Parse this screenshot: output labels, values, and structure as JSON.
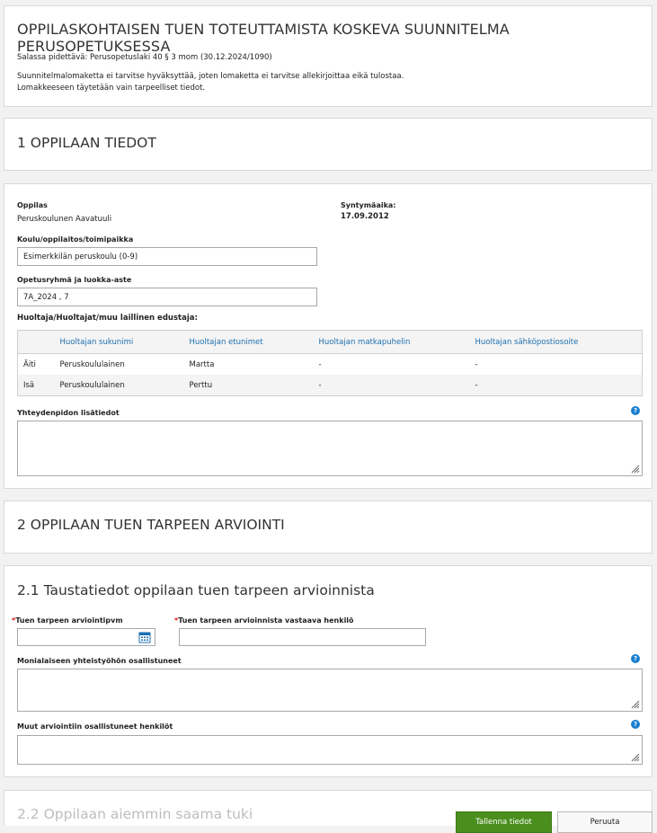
{
  "header": {
    "title": "OPPILASKOHTAISEN TUEN TOTEUTTAMISTA KOSKEVA SUUNNITELMA PERUSOPETUKSESSA",
    "confidential": "Salassa pidettävä: Perusopetuslaki 40 § 3 mom (30.12.2024/1090)",
    "note_line1": "Suunnitelmalomaketta ei tarvitse hyväksyttää, joten lomaketta ei tarvitse allekirjoittaa eikä tulostaa.",
    "note_line2": "Lomakkeeseen täytetään vain tarpeelliset tiedot."
  },
  "section1": {
    "title": "1 OPPILAAN TIEDOT"
  },
  "student": {
    "student_label": "Oppilas",
    "student_name": "Peruskoulunen Aavatuuli",
    "birth_label": "Syntymäaika:",
    "birth_date": "17.09.2012",
    "school_label": "Koulu/oppilaitos/toimipaikka",
    "school_value": "Esimerkkilän peruskoulu (0-9)",
    "group_label": "Opetusryhmä ja luokka-aste",
    "group_value": "7A_2024 , 7",
    "guardians_label": "Huoltaja/Huoltajat/muu laillinen edustaja:",
    "guardians_table": {
      "headers": [
        "",
        "Huoltajan sukunimi",
        "Huoltajan etunimet",
        "Huoltajan matkapuhelin",
        "Huoltajan sähköpostiosoite"
      ],
      "rows": [
        [
          "Äiti",
          "Peruskoululainen",
          "Martta",
          "-",
          "-"
        ],
        [
          "Isä",
          "Peruskoululainen",
          "Perttu",
          "-",
          "-"
        ]
      ]
    },
    "contact_label": "Yhteydenpidon lisätiedot"
  },
  "section2": {
    "title": "2 OPPILAAN TUEN TARPEEN ARVIOINTI"
  },
  "section21": {
    "title": "2.1 Taustatiedot oppilaan tuen tarpeen arvioinnista",
    "date_label": "Tuen tarpeen arviointipvm",
    "person_label": "Tuen tarpeen arvioinnista vastaava henkilö",
    "multi_label": "Monialaiseen yhteistyöhön osallistuneet",
    "others_label": "Muut arviointiin osallistuneet henkilöt",
    "required_mark": "*"
  },
  "section22": {
    "title": "2.2 Oppilaan aiemmin saama tuki"
  },
  "help_glyph": "?",
  "buttons": {
    "save": "Tallenna tiedot",
    "cancel": "Peruuta"
  },
  "colors": {
    "save_button": "#4a8f1d",
    "link_blue": "#1d6fb0",
    "help_icon": "#1a7fd0",
    "required": "#dd1111"
  }
}
